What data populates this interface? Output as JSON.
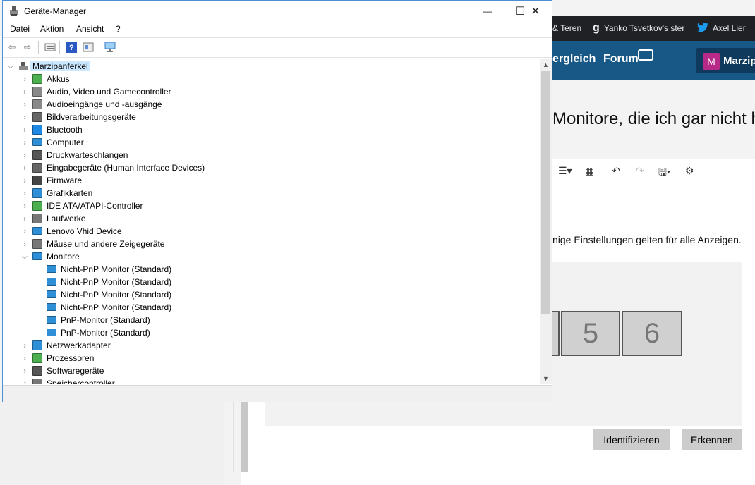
{
  "browser": {
    "tabs": [
      {
        "icon": "&",
        "label": "& Teren"
      },
      {
        "icon": "g",
        "label": "Yanko Tsvetkov's ster"
      },
      {
        "icon": "twitter",
        "label": "Axel Lier"
      }
    ]
  },
  "forum": {
    "nav": [
      "ergleich",
      "Forum"
    ],
    "user": {
      "initial": "M",
      "name": "Marzip"
    },
    "thread_title": "Monitore, die ich gar nicht h",
    "settings_note": "nige Einstellungen gelten für alle Anzeigen.",
    "monitors": [
      "5",
      "6"
    ],
    "buttons": {
      "identify": "Identifizieren",
      "detect": "Erkennen"
    }
  },
  "device_manager": {
    "title": "Geräte-Manager",
    "window_buttons": {
      "minimize": "—",
      "maximize": "☐",
      "close": "✕"
    },
    "menu": [
      "Datei",
      "Aktion",
      "Ansicht",
      "?"
    ],
    "tree": {
      "root": "Marzipanferkel",
      "categories": [
        {
          "label": "Akkus",
          "icon": "battery",
          "color": "#4caf50"
        },
        {
          "label": "Audio, Video und Gamecontroller",
          "icon": "speaker",
          "color": "#888888"
        },
        {
          "label": "Audioeingänge und -ausgänge",
          "icon": "speaker",
          "color": "#888888"
        },
        {
          "label": "Bildverarbeitungsgeräte",
          "icon": "camera",
          "color": "#666666"
        },
        {
          "label": "Bluetooth",
          "icon": "bluetooth",
          "color": "#1e88e5"
        },
        {
          "label": "Computer",
          "icon": "monitor",
          "color": "#2f8fd6"
        },
        {
          "label": "Druckwarteschlangen",
          "icon": "printer",
          "color": "#555555"
        },
        {
          "label": "Eingabegeräte (Human Interface Devices)",
          "icon": "keyboard",
          "color": "#666666"
        },
        {
          "label": "Firmware",
          "icon": "chip",
          "color": "#444444"
        },
        {
          "label": "Grafikkarten",
          "icon": "display-adapter",
          "color": "#2f8fd6"
        },
        {
          "label": "IDE ATA/ATAPI-Controller",
          "icon": "controller",
          "color": "#4caf50"
        },
        {
          "label": "Laufwerke",
          "icon": "drive",
          "color": "#777777"
        },
        {
          "label": "Lenovo Vhid Device",
          "icon": "monitor",
          "color": "#2f8fd6"
        },
        {
          "label": "Mäuse und andere Zeigegeräte",
          "icon": "mouse",
          "color": "#777777"
        },
        {
          "label": "Monitore",
          "icon": "monitor",
          "color": "#2f8fd6",
          "expanded": true
        }
      ],
      "monitors": [
        "Nicht-PnP Monitor (Standard)",
        "Nicht-PnP Monitor (Standard)",
        "Nicht-PnP Monitor (Standard)",
        "Nicht-PnP Monitor (Standard)",
        "PnP-Monitor (Standard)",
        "PnP-Monitor (Standard)"
      ],
      "after": [
        {
          "label": "Netzwerkadapter",
          "icon": "network",
          "color": "#2f8fd6"
        },
        {
          "label": "Prozessoren",
          "icon": "cpu",
          "color": "#4caf50"
        },
        {
          "label": "Softwaregeräte",
          "icon": "software",
          "color": "#555555"
        },
        {
          "label": "Speichercontroller",
          "icon": "storage",
          "color": "#777777"
        }
      ]
    }
  }
}
